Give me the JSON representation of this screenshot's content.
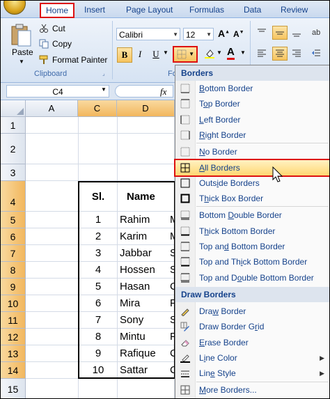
{
  "tabs": [
    "Home",
    "Insert",
    "Page Layout",
    "Formulas",
    "Data",
    "Review"
  ],
  "clipboard": {
    "cut": "Cut",
    "copy": "Copy",
    "paste": "Paste",
    "format_painter": "Format Painter",
    "group": "Clipboard"
  },
  "font": {
    "name": "Calibri",
    "size": "12",
    "group_partial": "Fo"
  },
  "namebox": "C4",
  "fx": "fx",
  "columns": [
    "A",
    "C",
    "D"
  ],
  "rows": [
    "1",
    "2",
    "3",
    "4",
    "5",
    "6",
    "7",
    "8",
    "9",
    "10",
    "11",
    "12",
    "13",
    "14",
    "15"
  ],
  "table": {
    "headers": [
      "Sl.",
      "Name"
    ],
    "rows": [
      [
        "1",
        "Rahim",
        "M"
      ],
      [
        "2",
        "Karim",
        "M"
      ],
      [
        "3",
        "Jabbar",
        "S"
      ],
      [
        "4",
        "Hossen",
        "S"
      ],
      [
        "5",
        "Hasan",
        "C"
      ],
      [
        "6",
        "Mira",
        "P"
      ],
      [
        "7",
        "Sony",
        "S"
      ],
      [
        "8",
        "Mintu",
        "F"
      ],
      [
        "9",
        "Rafique",
        "C"
      ],
      [
        "10",
        "Sattar",
        "C"
      ]
    ]
  },
  "menu": {
    "header": "Borders",
    "items": [
      "Bottom Border",
      "Top Border",
      "Left Border",
      "Right Border",
      "No Border",
      "All Borders",
      "Outside Borders",
      "Thick Box Border",
      "Bottom Double Border",
      "Thick Bottom Border",
      "Top and Bottom Border",
      "Top and Thick Bottom Border",
      "Top and Double Bottom Border"
    ],
    "draw_header": "Draw Borders",
    "draw_items": [
      "Draw Border",
      "Draw Border Grid",
      "Erase Border",
      "Line Color",
      "Line Style",
      "More Borders..."
    ]
  },
  "colors": {
    "accent": "#d11111",
    "highlight": "#ffd772",
    "selected_header": "#f2b75d",
    "ribbon": "#d6e3f3"
  }
}
